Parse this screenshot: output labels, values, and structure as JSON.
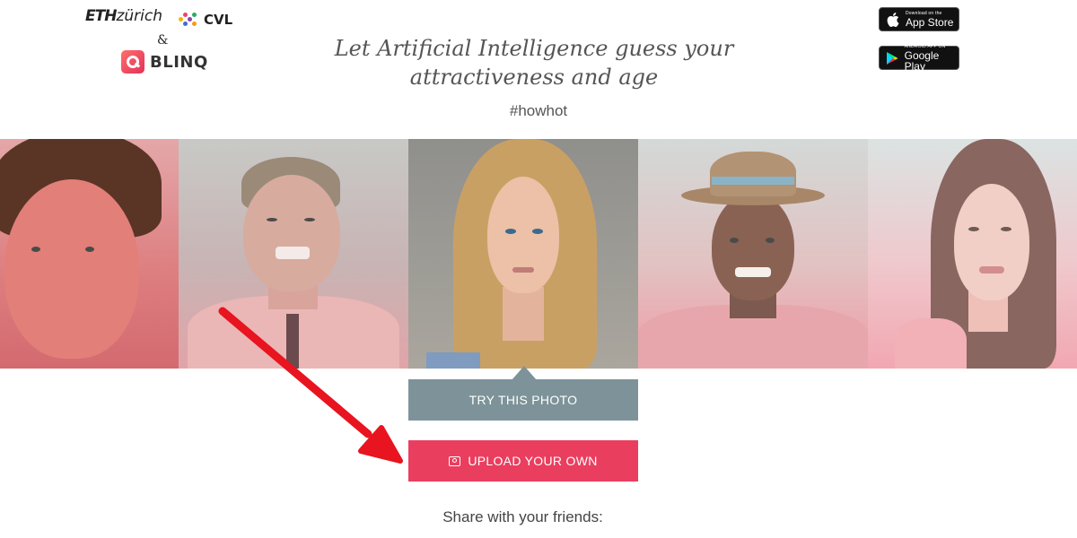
{
  "logos": {
    "eth_bold": "ETH",
    "eth_light": "zürich",
    "cvl": "CVL",
    "ampersand": "&",
    "blinq": "BLINQ"
  },
  "headline": {
    "line1": "Let Artificial Intelligence guess your",
    "line2": "attractiveness and age",
    "hashtag": "#howhot"
  },
  "badges": {
    "app_store_small": "Download on the",
    "app_store_big": "App Store",
    "google_play_small": "ANDROID APP ON",
    "google_play_big": "Google Play"
  },
  "photos": [
    {
      "icon": "man-face-photo"
    },
    {
      "icon": "grimacing-man-photo"
    },
    {
      "icon": "blonde-woman-photo"
    },
    {
      "icon": "man-with-hat-photo"
    },
    {
      "icon": "smiling-woman-photo"
    }
  ],
  "buttons": {
    "try_photo": "TRY THIS PHOTO",
    "upload_own": "UPLOAD YOUR OWN"
  },
  "share_text": "Share with your friends:",
  "colors": {
    "try_button": "#7d9399",
    "upload_button": "#ea3e5f",
    "arrow": "#e8141f"
  }
}
